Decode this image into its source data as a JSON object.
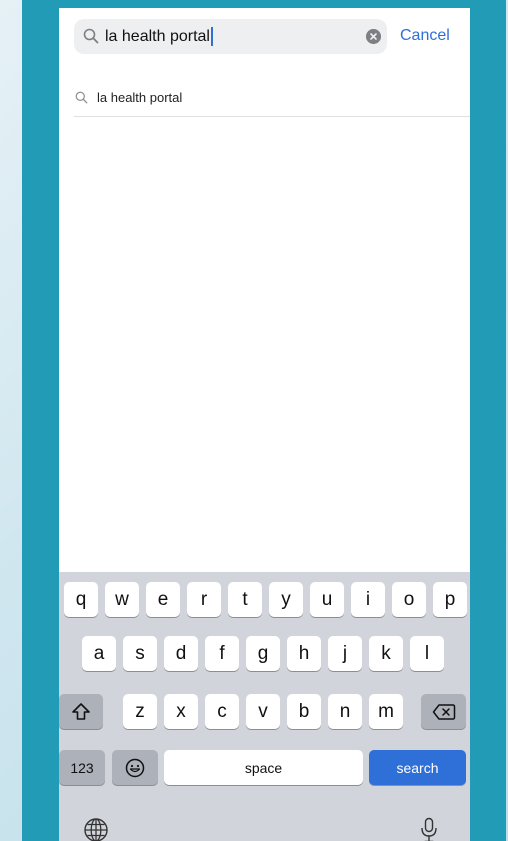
{
  "search": {
    "value": "la health portal",
    "cancel_label": "Cancel"
  },
  "suggestions": [
    {
      "text": "la health portal"
    }
  ],
  "keyboard": {
    "row1": [
      "q",
      "w",
      "e",
      "r",
      "t",
      "y",
      "u",
      "i",
      "o",
      "p"
    ],
    "row2": [
      "a",
      "s",
      "d",
      "f",
      "g",
      "h",
      "j",
      "k",
      "l"
    ],
    "row3": [
      "z",
      "x",
      "c",
      "v",
      "b",
      "n",
      "m"
    ],
    "numbers_label": "123",
    "space_label": "space",
    "return_label": "search"
  },
  "colors": {
    "frame": "#229bb6",
    "accent": "#2f6fd8",
    "keyboard_bg": "#d1d4db"
  }
}
